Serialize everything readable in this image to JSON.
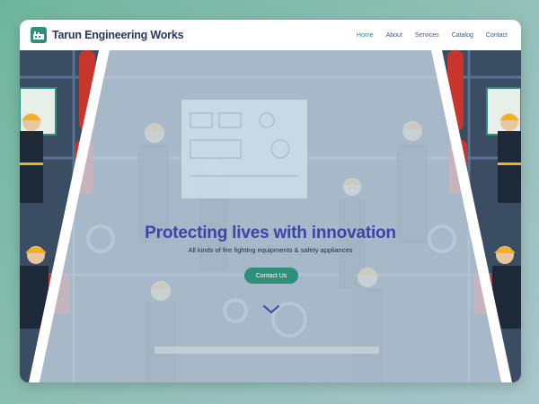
{
  "brand": {
    "name": "Tarun Engineering Works",
    "logo_icon": "factory-logo-icon"
  },
  "nav": {
    "items": [
      {
        "label": "Home",
        "active": true
      },
      {
        "label": "About",
        "active": false
      },
      {
        "label": "Services",
        "active": false
      },
      {
        "label": "Catalog",
        "active": false
      },
      {
        "label": "Contact",
        "active": false
      }
    ]
  },
  "hero": {
    "headline": "Protecting lives with innovation",
    "subline": "All kinds of fire fighting equipments & safety appliances",
    "cta_label": "Contact Us",
    "scroll_icon": "chevron-down-icon"
  },
  "colors": {
    "accent": "#2f8f7a",
    "headline": "#3d44a8",
    "brand_text": "#2d3560",
    "helmet": "#f0b020",
    "equipment_red": "#c8352c"
  }
}
